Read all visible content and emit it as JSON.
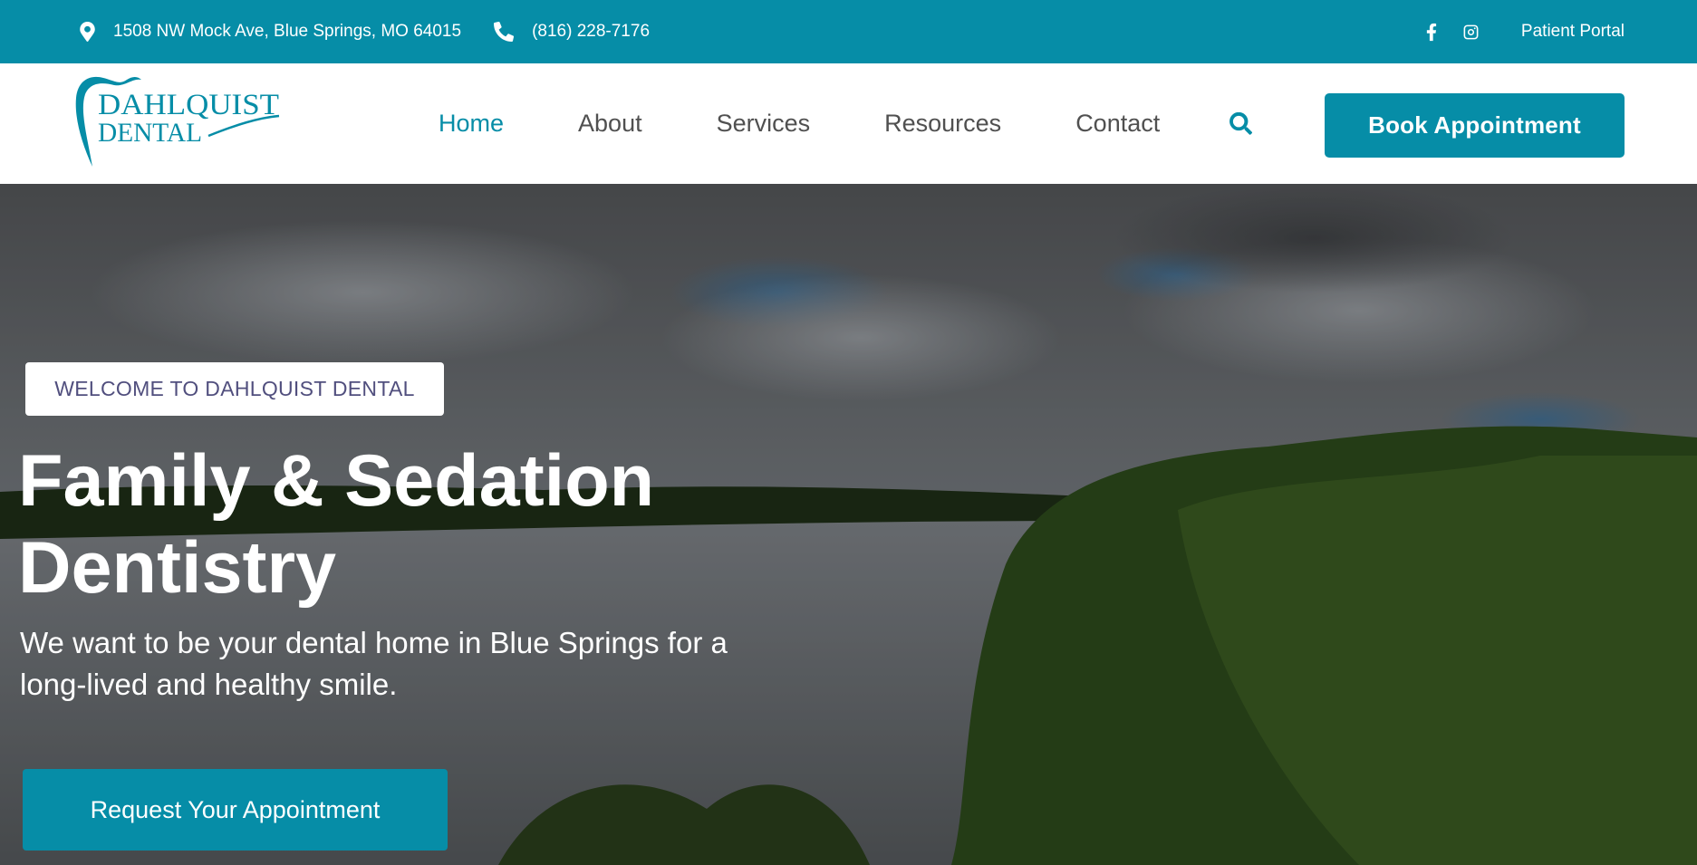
{
  "topbar": {
    "address": "1508 NW Mock Ave, Blue Springs, MO 64015",
    "phone": "(816) 228-7176",
    "portal_label": "Patient Portal",
    "address_icon": "map-pin-icon",
    "phone_icon": "phone-icon",
    "social": [
      "facebook-icon",
      "instagram-icon"
    ]
  },
  "logo": {
    "line1": "DAHLQUIST",
    "line2": "DENTAL"
  },
  "nav": {
    "items": [
      {
        "label": "Home",
        "active": true
      },
      {
        "label": "About",
        "active": false
      },
      {
        "label": "Services",
        "active": false
      },
      {
        "label": "Resources",
        "active": false
      },
      {
        "label": "Contact",
        "active": false
      }
    ],
    "search_icon": "search-icon",
    "book_label": "Book Appointment"
  },
  "hero": {
    "badge": "WELCOME TO DAHLQUIST DENTAL",
    "title_line1": "Family & Sedation",
    "title_line2": "Dentistry",
    "subtitle_line1": "We want to be your dental home in Blue Springs for a",
    "subtitle_line2": "long-lived and healthy smile.",
    "cta_label": "Request Your Appointment"
  },
  "colors": {
    "brand": "#068da7",
    "badge_text": "#514f7e",
    "nav_text": "#505050"
  }
}
